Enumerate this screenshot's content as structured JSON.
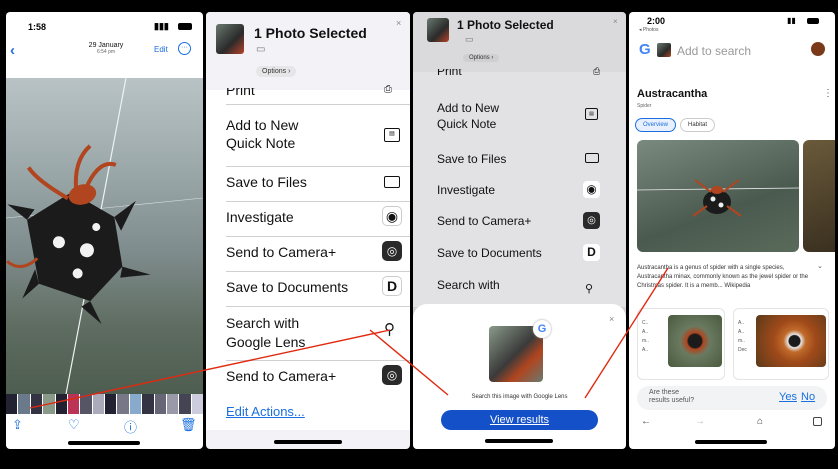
{
  "photos_panel": {
    "time": "1:58",
    "date": "29 January",
    "date_sub": "6:54 pm",
    "edit_label": "Edit"
  },
  "share_sheet_1": {
    "title": "1 Photo Selected",
    "options_label": "Options",
    "partial_top": "Print",
    "items": [
      {
        "label_line1": "Add to New",
        "label_line2": "Quick Note",
        "icon": "quick-note-icon"
      },
      {
        "label_line1": "Save to Files",
        "label_line2": "",
        "icon": "folder-icon"
      },
      {
        "label_line1": "Investigate",
        "label_line2": "",
        "icon": "investigate-app-icon"
      },
      {
        "label_line1": "Send to Camera+",
        "label_line2": "",
        "icon": "camera-plus-icon"
      },
      {
        "label_line1": "Save to Documents",
        "label_line2": "",
        "icon": "documents-icon"
      },
      {
        "label_line1": "Search with",
        "label_line2": "Google Lens",
        "icon": "search-icon"
      },
      {
        "label_line1": "Send to Camera+",
        "label_line2": "",
        "icon": "camera-plus-icon"
      }
    ],
    "edit_actions": "Edit Actions..."
  },
  "share_sheet_2": {
    "title": "1 Photo Selected",
    "options_label": "Options",
    "partial_top": "Print",
    "items": [
      {
        "label_line1": "Add to New",
        "label_line2": "Quick Note"
      },
      {
        "label_line1": "Save to Files",
        "label_line2": ""
      },
      {
        "label_line1": "Investigate",
        "label_line2": ""
      },
      {
        "label_line1": "Send to Camera+",
        "label_line2": ""
      },
      {
        "label_line1": "Save to Documents",
        "label_line2": ""
      },
      {
        "label_line1": "Search with",
        "label_line2": ""
      }
    ],
    "lens_caption": "Search this image with Google Lens",
    "view_results": "View results"
  },
  "google_panel": {
    "time": "2:00",
    "back_app": "◂ Photos",
    "search_placeholder": "Add to search",
    "result_title": "Austracantha",
    "result_sub": "Spider",
    "chips": [
      "Overview",
      "Habitat"
    ],
    "snippet": "Austracantha is a genus of spider with a single species, Austracantha minax, commonly known as the jewel spider or the Christmas spider. It is a memb... Wikipedia",
    "feedback_q1": "Are these",
    "feedback_q2": "results useful?",
    "yes": "Yes",
    "no": "No"
  },
  "colors": {
    "ios_blue": "#1a6fe0",
    "lens_button": "#1450c8",
    "annotation_red": "#e02a10"
  }
}
